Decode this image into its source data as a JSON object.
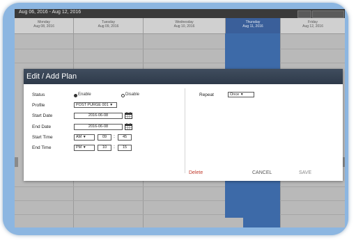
{
  "calendar": {
    "range_label": "Aug 06, 2016 - Aug 12, 2016",
    "days": [
      {
        "name": "Monday",
        "date": "Aug 08, 2016"
      },
      {
        "name": "Tuesday",
        "date": "Aug 09, 2016"
      },
      {
        "name": "Wednesday",
        "date": "Aug 10, 2016"
      },
      {
        "name": "Thursday",
        "date": "Aug 11, 2016"
      },
      {
        "name": "Friday",
        "date": "Aug 12, 2016"
      }
    ]
  },
  "dialog": {
    "title": "Edit / Add Plan",
    "status_label": "Status",
    "status_options": [
      "Enable",
      "Disable"
    ],
    "status_selected": "Enable",
    "profile_label": "Profile",
    "profile_value": "POST PURGE 001",
    "start_date_label": "Start Date",
    "start_date_value": "2016-06-08",
    "end_date_label": "End Date",
    "end_date_value": "2016-06-08",
    "start_time_label": "Start Time",
    "start_time": {
      "ampm": "AM",
      "hour": "09",
      "minute": "45"
    },
    "end_time_label": "End Time",
    "end_time": {
      "ampm": "PM",
      "hour": "10",
      "minute": "15"
    },
    "repeat_label": "Repeat",
    "repeat_value": "Once",
    "delete_label": "Delete",
    "cancel_label": "CANCEL",
    "save_label": "SAVE",
    "colors": {
      "delete": "#c0392b",
      "title_bar": "#2e3a4a",
      "selected_column": "#3d6aa8"
    }
  }
}
